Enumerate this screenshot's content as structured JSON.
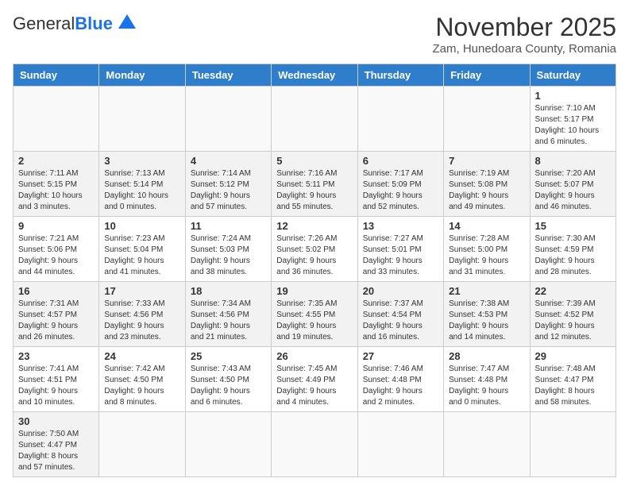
{
  "header": {
    "logo": {
      "general": "General",
      "blue": "Blue"
    },
    "title": "November 2025",
    "subtitle": "Zam, Hunedoara County, Romania"
  },
  "calendar": {
    "days_of_week": [
      "Sunday",
      "Monday",
      "Tuesday",
      "Wednesday",
      "Thursday",
      "Friday",
      "Saturday"
    ],
    "weeks": [
      [
        {
          "day": "",
          "info": ""
        },
        {
          "day": "",
          "info": ""
        },
        {
          "day": "",
          "info": ""
        },
        {
          "day": "",
          "info": ""
        },
        {
          "day": "",
          "info": ""
        },
        {
          "day": "",
          "info": ""
        },
        {
          "day": "1",
          "info": "Sunrise: 7:10 AM\nSunset: 5:17 PM\nDaylight: 10 hours\nand 6 minutes."
        }
      ],
      [
        {
          "day": "2",
          "info": "Sunrise: 7:11 AM\nSunset: 5:15 PM\nDaylight: 10 hours\nand 3 minutes."
        },
        {
          "day": "3",
          "info": "Sunrise: 7:13 AM\nSunset: 5:14 PM\nDaylight: 10 hours\nand 0 minutes."
        },
        {
          "day": "4",
          "info": "Sunrise: 7:14 AM\nSunset: 5:12 PM\nDaylight: 9 hours\nand 57 minutes."
        },
        {
          "day": "5",
          "info": "Sunrise: 7:16 AM\nSunset: 5:11 PM\nDaylight: 9 hours\nand 55 minutes."
        },
        {
          "day": "6",
          "info": "Sunrise: 7:17 AM\nSunset: 5:09 PM\nDaylight: 9 hours\nand 52 minutes."
        },
        {
          "day": "7",
          "info": "Sunrise: 7:19 AM\nSunset: 5:08 PM\nDaylight: 9 hours\nand 49 minutes."
        },
        {
          "day": "8",
          "info": "Sunrise: 7:20 AM\nSunset: 5:07 PM\nDaylight: 9 hours\nand 46 minutes."
        }
      ],
      [
        {
          "day": "9",
          "info": "Sunrise: 7:21 AM\nSunset: 5:06 PM\nDaylight: 9 hours\nand 44 minutes."
        },
        {
          "day": "10",
          "info": "Sunrise: 7:23 AM\nSunset: 5:04 PM\nDaylight: 9 hours\nand 41 minutes."
        },
        {
          "day": "11",
          "info": "Sunrise: 7:24 AM\nSunset: 5:03 PM\nDaylight: 9 hours\nand 38 minutes."
        },
        {
          "day": "12",
          "info": "Sunrise: 7:26 AM\nSunset: 5:02 PM\nDaylight: 9 hours\nand 36 minutes."
        },
        {
          "day": "13",
          "info": "Sunrise: 7:27 AM\nSunset: 5:01 PM\nDaylight: 9 hours\nand 33 minutes."
        },
        {
          "day": "14",
          "info": "Sunrise: 7:28 AM\nSunset: 5:00 PM\nDaylight: 9 hours\nand 31 minutes."
        },
        {
          "day": "15",
          "info": "Sunrise: 7:30 AM\nSunset: 4:59 PM\nDaylight: 9 hours\nand 28 minutes."
        }
      ],
      [
        {
          "day": "16",
          "info": "Sunrise: 7:31 AM\nSunset: 4:57 PM\nDaylight: 9 hours\nand 26 minutes."
        },
        {
          "day": "17",
          "info": "Sunrise: 7:33 AM\nSunset: 4:56 PM\nDaylight: 9 hours\nand 23 minutes."
        },
        {
          "day": "18",
          "info": "Sunrise: 7:34 AM\nSunset: 4:56 PM\nDaylight: 9 hours\nand 21 minutes."
        },
        {
          "day": "19",
          "info": "Sunrise: 7:35 AM\nSunset: 4:55 PM\nDaylight: 9 hours\nand 19 minutes."
        },
        {
          "day": "20",
          "info": "Sunrise: 7:37 AM\nSunset: 4:54 PM\nDaylight: 9 hours\nand 16 minutes."
        },
        {
          "day": "21",
          "info": "Sunrise: 7:38 AM\nSunset: 4:53 PM\nDaylight: 9 hours\nand 14 minutes."
        },
        {
          "day": "22",
          "info": "Sunrise: 7:39 AM\nSunset: 4:52 PM\nDaylight: 9 hours\nand 12 minutes."
        }
      ],
      [
        {
          "day": "23",
          "info": "Sunrise: 7:41 AM\nSunset: 4:51 PM\nDaylight: 9 hours\nand 10 minutes."
        },
        {
          "day": "24",
          "info": "Sunrise: 7:42 AM\nSunset: 4:50 PM\nDaylight: 9 hours\nand 8 minutes."
        },
        {
          "day": "25",
          "info": "Sunrise: 7:43 AM\nSunset: 4:50 PM\nDaylight: 9 hours\nand 6 minutes."
        },
        {
          "day": "26",
          "info": "Sunrise: 7:45 AM\nSunset: 4:49 PM\nDaylight: 9 hours\nand 4 minutes."
        },
        {
          "day": "27",
          "info": "Sunrise: 7:46 AM\nSunset: 4:48 PM\nDaylight: 9 hours\nand 2 minutes."
        },
        {
          "day": "28",
          "info": "Sunrise: 7:47 AM\nSunset: 4:48 PM\nDaylight: 9 hours\nand 0 minutes."
        },
        {
          "day": "29",
          "info": "Sunrise: 7:48 AM\nSunset: 4:47 PM\nDaylight: 8 hours\nand 58 minutes."
        }
      ],
      [
        {
          "day": "30",
          "info": "Sunrise: 7:50 AM\nSunset: 4:47 PM\nDaylight: 8 hours\nand 57 minutes."
        },
        {
          "day": "",
          "info": ""
        },
        {
          "day": "",
          "info": ""
        },
        {
          "day": "",
          "info": ""
        },
        {
          "day": "",
          "info": ""
        },
        {
          "day": "",
          "info": ""
        },
        {
          "day": "",
          "info": ""
        }
      ]
    ]
  }
}
